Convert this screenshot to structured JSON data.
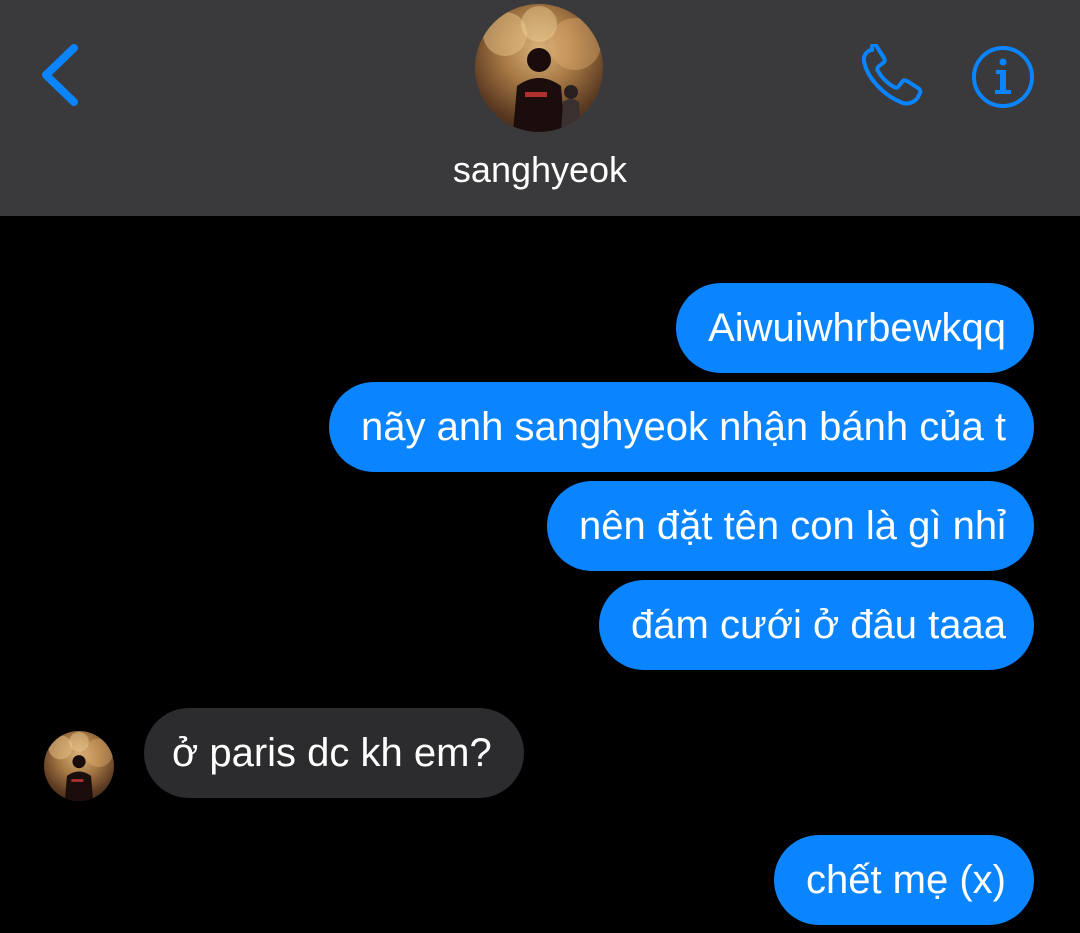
{
  "header": {
    "contact_name": "sanghyeok",
    "background": "#3a3a3c",
    "icons": {
      "back": "chevron-left-icon",
      "call": "phone-icon",
      "info": "info-icon"
    },
    "accent": "#0a84ff"
  },
  "messages": [
    {
      "from": "me",
      "text": "Aiwuiwhrbewkqq"
    },
    {
      "from": "me",
      "text": "nãy anh sanghyeok nhận bánh của t"
    },
    {
      "from": "me",
      "text": "nên đặt tên con là gì nhỉ"
    },
    {
      "from": "me",
      "text": "đám cưới ở đâu taaa"
    },
    {
      "from": "contact",
      "text": "ở paris dc kh em?"
    },
    {
      "from": "me",
      "text": "chết mẹ (x)"
    }
  ],
  "colors": {
    "sent_bubble": "#0a84ff",
    "received_bubble": "#2c2c2e",
    "background": "#000000"
  }
}
